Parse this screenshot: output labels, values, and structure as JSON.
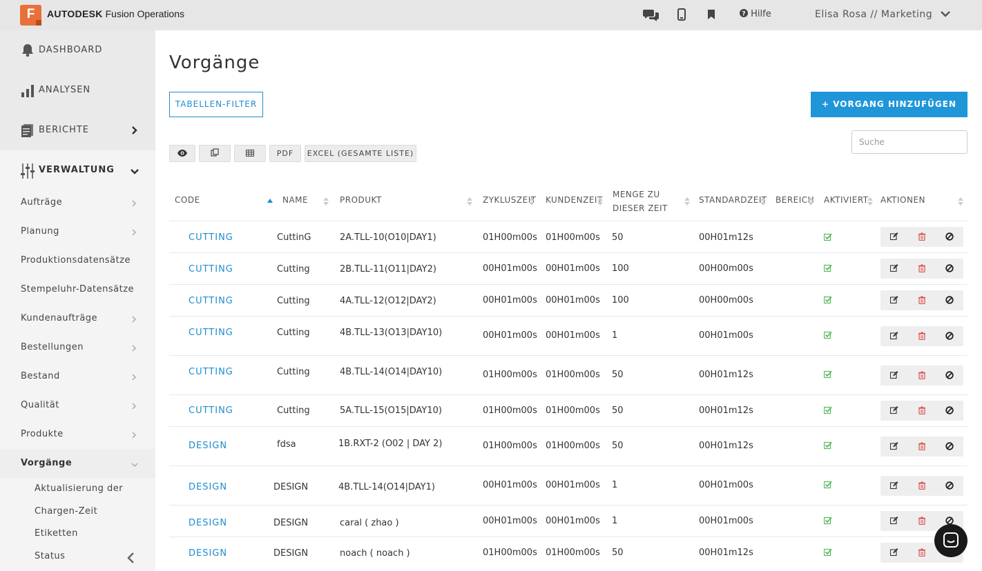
{
  "app": {
    "logo_letter": "F",
    "brand_bold": "AUTODESK",
    "brand_rest": " Fusion Operations",
    "help_label": "Hilfe",
    "user_label": "Elisa Rosa // Marketing"
  },
  "sidebar": {
    "main": [
      {
        "label": "DASHBOARD",
        "icon": "bell-icon"
      },
      {
        "label": "ANALYSEN",
        "icon": "bar-chart-icon"
      },
      {
        "label": "BERICHTE",
        "icon": "reports-icon"
      },
      {
        "label": "VERWALTUNG",
        "icon": "sliders-icon"
      }
    ],
    "items": [
      {
        "label": "Aufträge"
      },
      {
        "label": "Planung"
      },
      {
        "label": "Produktionsdatensätze"
      },
      {
        "label": "Stempeluhr-Datensätze"
      },
      {
        "label": "Kundenaufträge"
      },
      {
        "label": "Bestellungen"
      },
      {
        "label": "Bestand"
      },
      {
        "label": "Qualität"
      },
      {
        "label": "Produkte"
      },
      {
        "label": "Vorgänge"
      }
    ],
    "sub_items": [
      {
        "label": "Aktualisierung der"
      },
      {
        "label": "Chargen-Zeit"
      },
      {
        "label": "Etiketten"
      },
      {
        "label": "Status"
      }
    ]
  },
  "page": {
    "title": "Vorgänge",
    "filter_button": "TABELLEN-FILTER",
    "add_button": "+ VORGANG HINZUFÜGEN",
    "search_placeholder": "Suche",
    "toolbar": {
      "pdf": "PDF",
      "excel": "EXCEL (GESAMTE LISTE)"
    }
  },
  "table": {
    "headers": {
      "code": "CODE",
      "name": "NAME",
      "product": "PRODUKT",
      "cycle": "ZYKLUSZEIT",
      "customer": "KUNDENZEIT",
      "qty_line1": "MENGE ZU",
      "qty_line2": "DIESER ZEIT",
      "standard": "STANDARDZEIT",
      "area": "BEREICH",
      "active": "AKTIVIERT",
      "actions": "AKTIONEN"
    },
    "rows": [
      {
        "code": "CUTTING",
        "name": "CuttinG",
        "product": "2A.TLL-10(O10|DAY1)",
        "cycle": "01H00m00s",
        "customer": "01H00m00s",
        "qty": "50",
        "standard": "00H01m12s",
        "area": "",
        "active": true
      },
      {
        "code": "CUTTING",
        "name": "Cutting",
        "product": "2B.TLL-11(O11|DAY2)",
        "cycle": "00H01m00s",
        "customer": "00H01m00s",
        "qty": "100",
        "standard": "00H00m00s",
        "area": "",
        "active": true
      },
      {
        "code": "CUTTING",
        "name": "Cutting",
        "product": "4A.TLL-12(O12|DAY2)",
        "cycle": "00H01m00s",
        "customer": "00H01m00s",
        "qty": "100",
        "standard": "00H00m00s",
        "area": "",
        "active": true
      },
      {
        "code": "CUTTING",
        "name": "Cutting",
        "product": "4B.TLL-13(O13|DAY10)",
        "cycle": "00H01m00s",
        "customer": "00H01m00s",
        "qty": "1",
        "standard": "00H01m00s",
        "area": "",
        "active": true
      },
      {
        "code": "CUTTING",
        "name": "Cutting",
        "product": "4B.TLL-14(O14|DAY10)",
        "cycle": "01H00m00s",
        "customer": "01H00m00s",
        "qty": "50",
        "standard": "00H01m12s",
        "area": "",
        "active": true
      },
      {
        "code": "CUTTING",
        "name": "Cutting",
        "product": "5A.TLL-15(O15|DAY10)",
        "cycle": "01H00m00s",
        "customer": "01H00m00s",
        "qty": "50",
        "standard": "00H01m12s",
        "area": "",
        "active": true
      },
      {
        "code": "DESIGN",
        "name": "fdsa",
        "product": "1B.RXT-2 (O02 | DAY 2)",
        "cycle": "01H00m00s",
        "customer": "01H00m00s",
        "qty": "50",
        "standard": "00H01m12s",
        "area": "",
        "active": true
      },
      {
        "code": "DESIGN",
        "name": "DESIGN",
        "product": "4B.TLL-14(O14|DAY1)",
        "cycle": "00H01m00s",
        "customer": "00H01m00s",
        "qty": "1",
        "standard": "00H01m00s",
        "area": "",
        "active": true
      },
      {
        "code": "DESIGN",
        "name": "DESIGN",
        "product": "caral ( zhao )",
        "cycle": "00H01m00s",
        "customer": "00H01m00s",
        "qty": "1",
        "standard": "00H01m00s",
        "area": "",
        "active": true
      },
      {
        "code": "DESIGN",
        "name": "DESIGN",
        "product": "noach ( noach )",
        "cycle": "01H00m00s",
        "customer": "01H00m00s",
        "qty": "50",
        "standard": "00H01m12s",
        "area": "",
        "active": true
      }
    ]
  },
  "colors": {
    "accent": "#1e8ccf",
    "check": "#5cb85c",
    "delete": "#d9534f",
    "topbar": "#e6e6e6",
    "logo": "#e8703a"
  }
}
